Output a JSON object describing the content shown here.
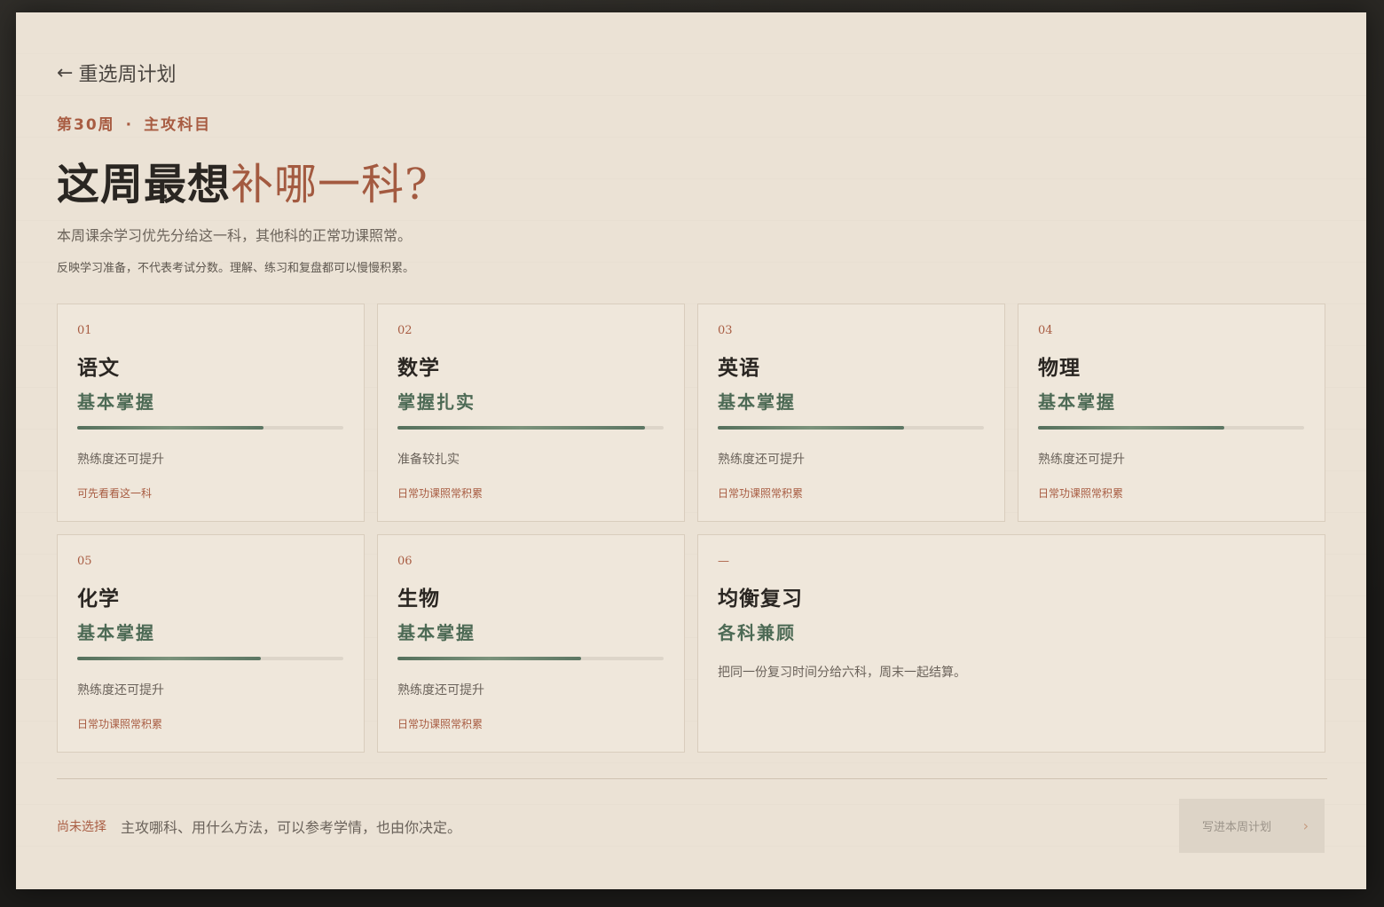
{
  "nav": {
    "back_label": "重选周计划",
    "back_arrow": "←"
  },
  "header": {
    "week": "第30周",
    "separator": "·",
    "section": "主攻科目",
    "title_plain": "这周最想",
    "title_accent": "补哪一科?",
    "subtitle": "本周课余学习优先分给这一科，其他科的正常功课照常。",
    "note": "反映学习准备，不代表考试分数。理解、练习和复盘都可以慢慢积累。"
  },
  "subjects": [
    {
      "num": "01",
      "name": "语文",
      "level": "基本掌握",
      "progress": 0.7,
      "status": "熟练度还可提升",
      "hint": "可先看看这一科"
    },
    {
      "num": "02",
      "name": "数学",
      "level": "掌握扎实",
      "progress": 0.93,
      "status": "准备较扎实",
      "hint": "日常功课照常积累"
    },
    {
      "num": "03",
      "name": "英语",
      "level": "基本掌握",
      "progress": 0.7,
      "status": "熟练度还可提升",
      "hint": "日常功课照常积累"
    },
    {
      "num": "04",
      "name": "物理",
      "level": "基本掌握",
      "progress": 0.7,
      "status": "熟练度还可提升",
      "hint": "日常功课照常积累"
    },
    {
      "num": "05",
      "name": "化学",
      "level": "基本掌握",
      "progress": 0.69,
      "status": "熟练度还可提升",
      "hint": "日常功课照常积累"
    },
    {
      "num": "06",
      "name": "生物",
      "level": "基本掌握",
      "progress": 0.69,
      "status": "熟练度还可提升",
      "hint": "日常功课照常积累"
    }
  ],
  "balanced": {
    "num": "—",
    "name": "均衡复习",
    "level": "各科兼顾",
    "desc": "把同一份复习时间分给六科，周末一起结算。"
  },
  "footer": {
    "status": "尚未选择",
    "message": "主攻哪科、用什么方法，可以参考学情，也由你决定。",
    "submit_label": "写进本周计划",
    "submit_icon": "chevron-right-icon"
  },
  "colors": {
    "accent": "#a85c42",
    "green": "#4d6a55",
    "panel": "#ebe2d5",
    "card": "#efe7db"
  }
}
